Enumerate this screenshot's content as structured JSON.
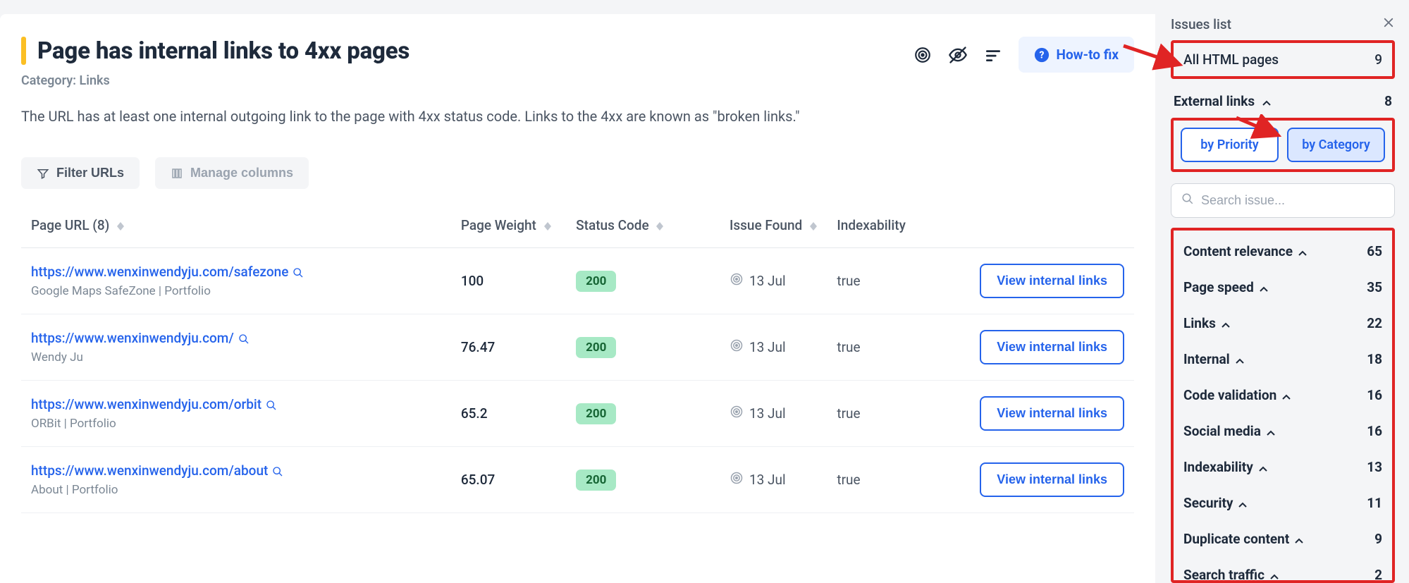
{
  "header": {
    "title": "Page has internal links to 4xx pages",
    "category_label": "Category: Links",
    "description": "The URL has at least one internal outgoing link to the page with 4xx status code. Links to the 4xx are known as \"broken links.\"",
    "howto_label": "How-to fix"
  },
  "toolbar": {
    "filter_label": "Filter URLs",
    "manage_columns_label": "Manage columns"
  },
  "table": {
    "columns": {
      "page_url": "Page URL (8)",
      "page_weight": "Page Weight",
      "status_code": "Status Code",
      "issue_found": "Issue Found",
      "indexability": "Indexability"
    },
    "view_button": "View internal links",
    "rows": [
      {
        "url": "https://www.wenxinwendyju.com/safezone",
        "subtitle": "Google Maps SafeZone | Portfolio",
        "page_weight": "100",
        "status_code": "200",
        "issue_found": "13 Jul",
        "indexability": "true"
      },
      {
        "url": "https://www.wenxinwendyju.com/",
        "subtitle": "Wendy Ju",
        "page_weight": "76.47",
        "status_code": "200",
        "issue_found": "13 Jul",
        "indexability": "true"
      },
      {
        "url": "https://www.wenxinwendyju.com/orbit",
        "subtitle": "ORBit | Portfolio",
        "page_weight": "65.2",
        "status_code": "200",
        "issue_found": "13 Jul",
        "indexability": "true"
      },
      {
        "url": "https://www.wenxinwendyju.com/about",
        "subtitle": "About | Portfolio",
        "page_weight": "65.07",
        "status_code": "200",
        "issue_found": "13 Jul",
        "indexability": "true"
      }
    ]
  },
  "side": {
    "title": "Issues list",
    "all_html": {
      "label": "All HTML pages",
      "count": "9"
    },
    "external_links": {
      "label": "External links",
      "count": "8"
    },
    "tabs": {
      "priority": "by Priority",
      "category": "by Category"
    },
    "search_placeholder": "Search issue...",
    "categories": [
      {
        "label": "Content relevance",
        "count": "65"
      },
      {
        "label": "Page speed",
        "count": "35"
      },
      {
        "label": "Links",
        "count": "22"
      },
      {
        "label": "Internal",
        "count": "18"
      },
      {
        "label": "Code validation",
        "count": "16"
      },
      {
        "label": "Social media",
        "count": "16"
      },
      {
        "label": "Indexability",
        "count": "13"
      },
      {
        "label": "Security",
        "count": "11"
      },
      {
        "label": "Duplicate content",
        "count": "9"
      },
      {
        "label": "Search traffic",
        "count": "2"
      }
    ]
  }
}
